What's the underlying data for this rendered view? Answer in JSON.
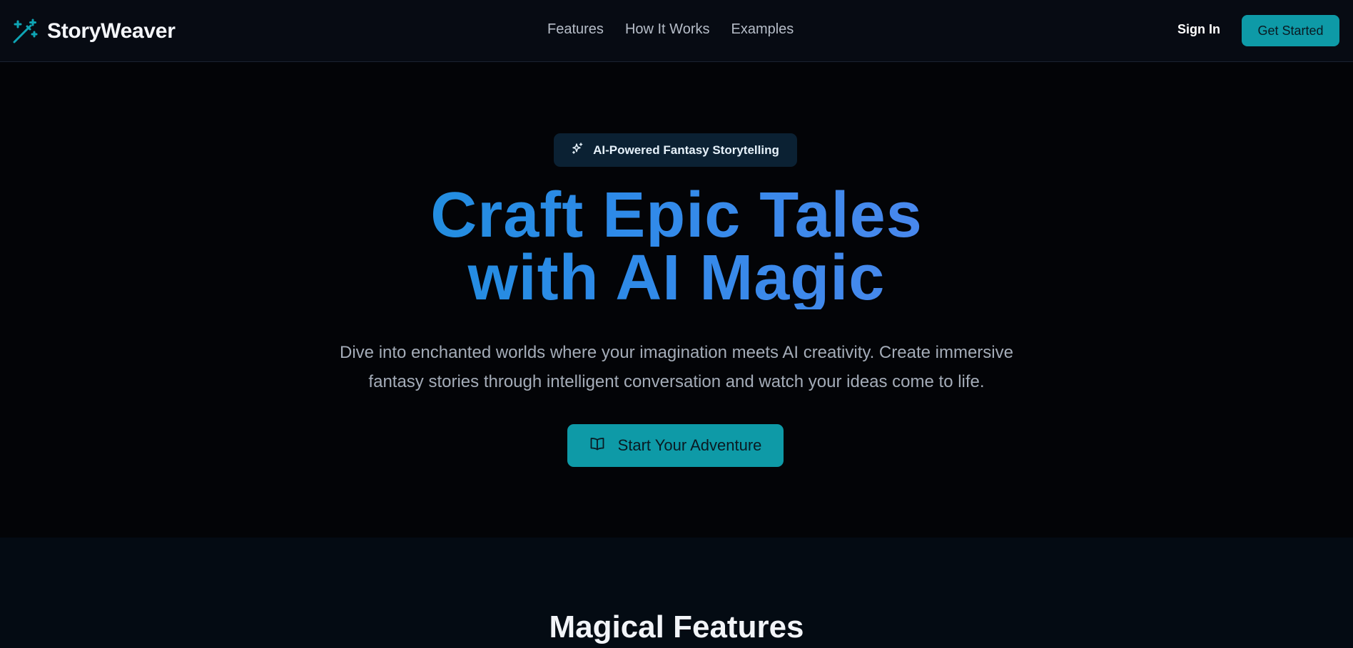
{
  "header": {
    "brand": "StoryWeaver",
    "nav": [
      "Features",
      "How It Works",
      "Examples"
    ],
    "sign_in": "Sign In",
    "get_started": "Get Started"
  },
  "hero": {
    "badge": "AI-Powered Fantasy Storytelling",
    "headline_line1": "Craft Epic Tales",
    "headline_line2": "with AI Magic",
    "subtitle_line1": "Dive into enchanted worlds where your imagination meets AI creativity. Create immersive",
    "subtitle_line2": "fantasy stories through intelligent conversation and watch your ideas come to life.",
    "cta": "Start Your Adventure"
  },
  "features": {
    "title": "Magical Features"
  },
  "icons": {
    "logo": "magic-wand-icon",
    "badge": "sparkles-icon",
    "cta": "book-open-icon"
  },
  "colors": {
    "accent": "#0e9aa7",
    "headline_gradient_start": "#0a95cc",
    "headline_gradient_end": "#6f86f4",
    "background": "#030407"
  }
}
